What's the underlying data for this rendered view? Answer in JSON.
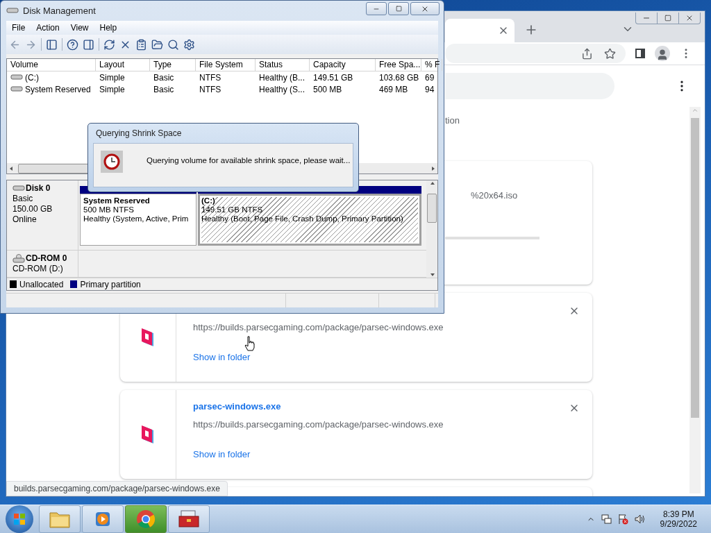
{
  "disk_management": {
    "title": "Disk Management",
    "menu": [
      "File",
      "Action",
      "View",
      "Help"
    ],
    "volumes": {
      "columns": [
        "Volume",
        "Layout",
        "Type",
        "File System",
        "Status",
        "Capacity",
        "Free Spa...",
        "% F"
      ],
      "rows": [
        [
          "(C:)",
          "Simple",
          "Basic",
          "NTFS",
          "Healthy (B...",
          "149.51 GB",
          "103.68 GB",
          "69"
        ],
        [
          "System Reserved",
          "Simple",
          "Basic",
          "NTFS",
          "Healthy (S...",
          "500 MB",
          "469 MB",
          "94"
        ]
      ]
    },
    "disks": [
      {
        "name": "Disk 0",
        "kind": "disk",
        "lines": [
          "Basic",
          "150.00 GB",
          "Online"
        ],
        "partitions": [
          {
            "name": "System Reserved",
            "size": "500 MB NTFS",
            "status": "Healthy (System, Active, Prim",
            "kind": "primary",
            "selected": false
          },
          {
            "name": "(C:)",
            "size": "149.51 GB NTFS",
            "status": "Healthy (Boot, Page File, Crash Dump, Primary Partition)",
            "kind": "primary",
            "selected": true
          }
        ]
      },
      {
        "name": "CD-ROM 0",
        "kind": "cdrom",
        "lines": [
          "CD-ROM (D:)"
        ]
      }
    ],
    "legend": [
      {
        "label": "Unallocated",
        "kind": "unallocated",
        "color": "#000000"
      },
      {
        "label": "Primary partition",
        "kind": "primary",
        "color": "#000080"
      }
    ],
    "dialog": {
      "title": "Querying Shrink Space",
      "message": "Querying volume for available shrink space, please wait..."
    }
  },
  "browser": {
    "partial_heading": "tion",
    "downloads": [
      {
        "kind": "partial",
        "file": "%20x64.iso"
      },
      {
        "kind": "done",
        "url": "https://builds.parsecgaming.com/package/parsec-windows.exe",
        "action": "Show in folder"
      },
      {
        "kind": "done",
        "title": "parsec-windows.exe",
        "url": "https://builds.parsecgaming.com/package/parsec-windows.exe",
        "action": "Show in folder"
      }
    ],
    "status_url": "builds.parsecgaming.com/package/parsec-windows.exe"
  },
  "taskbar": {
    "apps": [
      {
        "kind": "explorer",
        "selected": false
      },
      {
        "kind": "media",
        "selected": false
      },
      {
        "kind": "chrome",
        "selected": true
      },
      {
        "kind": "toolbox",
        "selected": false
      }
    ],
    "time": "8:39 PM",
    "date": "9/29/2022"
  }
}
